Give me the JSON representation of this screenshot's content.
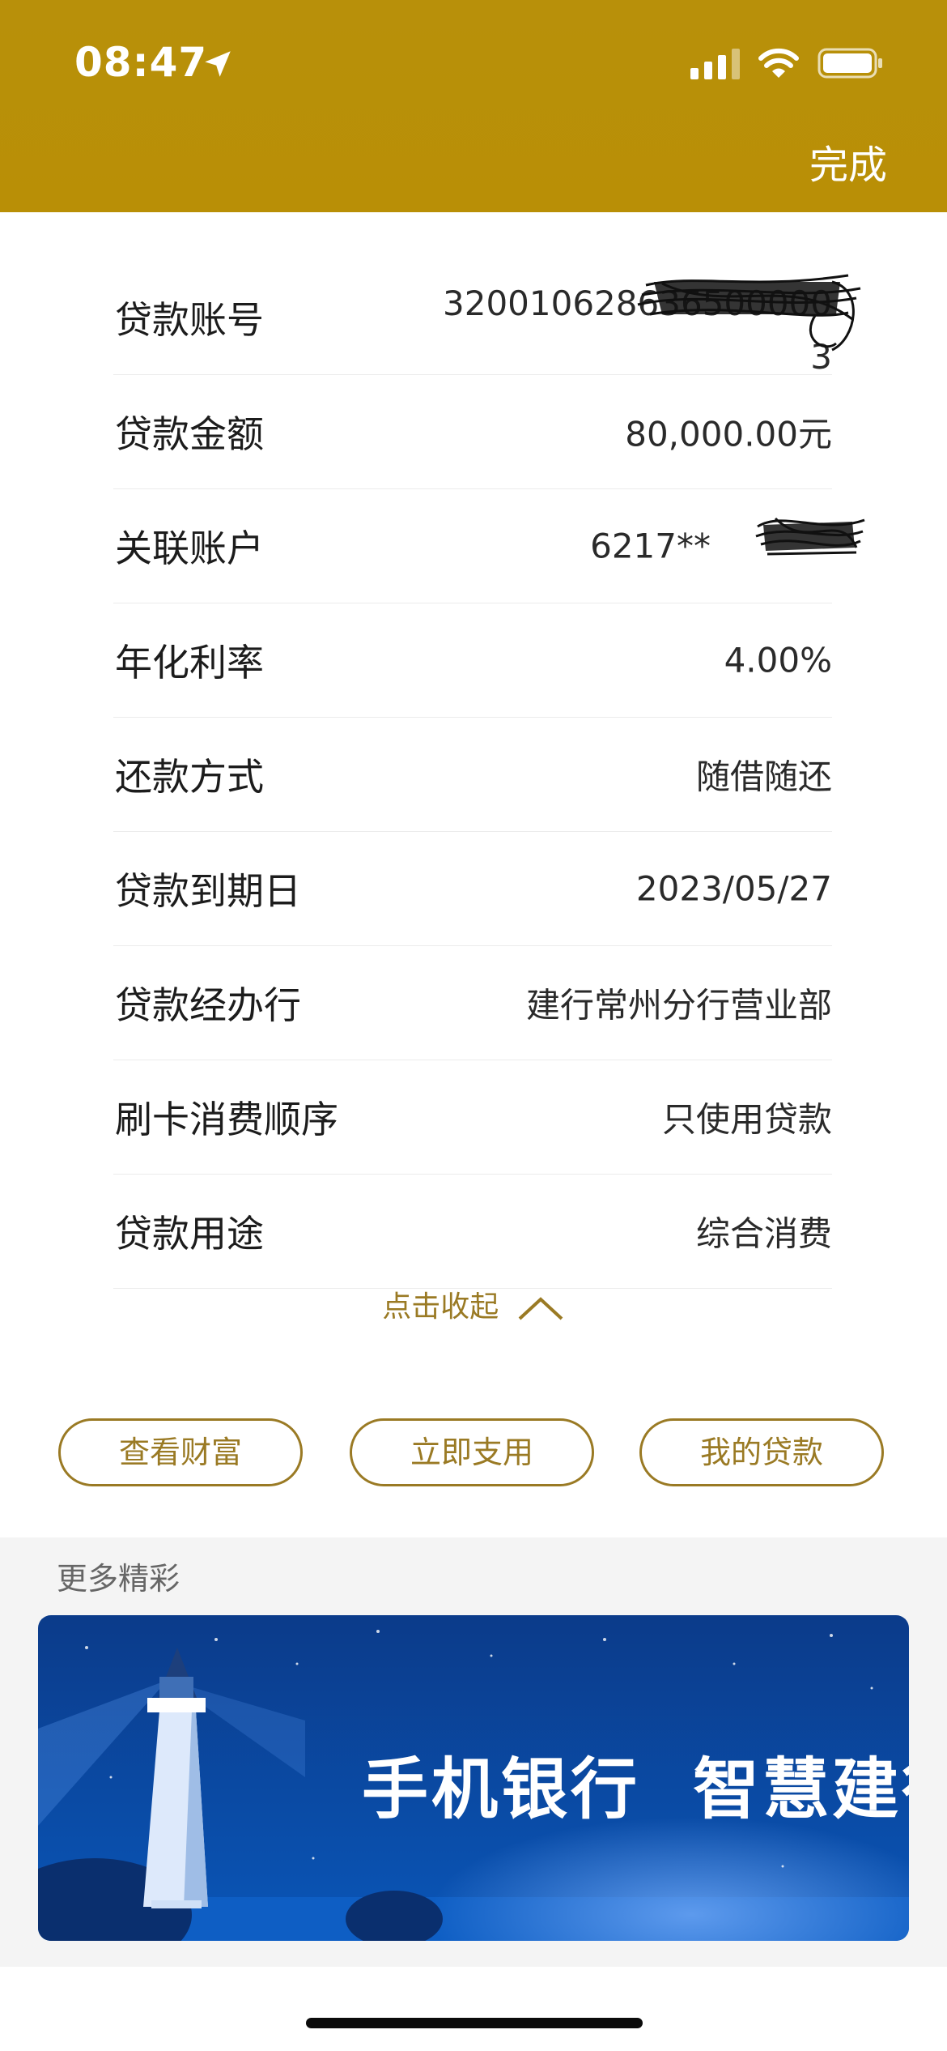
{
  "status_bar": {
    "time": "08:47"
  },
  "header": {
    "done_label": "完成"
  },
  "loan_details": [
    {
      "label": "贷款账号",
      "value": "320010628636500000\n3"
    },
    {
      "label": "贷款金额",
      "value": "80,000.00元"
    },
    {
      "label": "关联账户",
      "value": "6217**"
    },
    {
      "label": "年化利率",
      "value": "4.00%"
    },
    {
      "label": "还款方式",
      "value": "随借随还"
    },
    {
      "label": "贷款到期日",
      "value": "2023/05/27"
    },
    {
      "label": "贷款经办行",
      "value": "建行常州分行营业部"
    },
    {
      "label": "刷卡消费顺序",
      "value": "只使用贷款"
    },
    {
      "label": "贷款用途",
      "value": "综合消费"
    }
  ],
  "collapse_label": "点击收起",
  "actions": {
    "view_wealth": "查看财富",
    "use_now": "立即支用",
    "my_loans": "我的贷款"
  },
  "more": {
    "title": "更多精彩",
    "banner_text": "手机银行  智慧建行"
  },
  "colors": {
    "header": "#b8900a",
    "accent": "#9a7a24",
    "banner": "#0a4aa0"
  }
}
